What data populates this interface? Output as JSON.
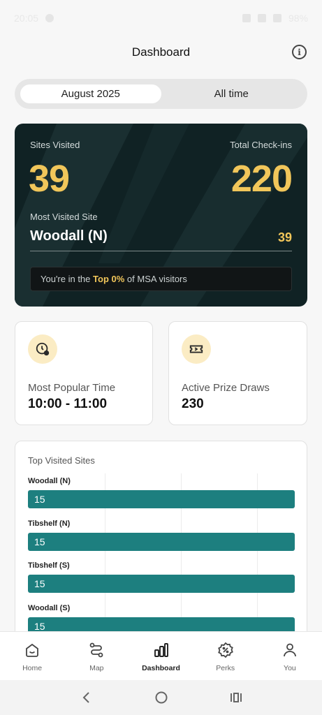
{
  "status_bar": {
    "time": "20:05",
    "battery": "98%"
  },
  "header": {
    "title": "Dashboard"
  },
  "segment": {
    "options": [
      "August 2025",
      "All time"
    ],
    "selected": "August 2025"
  },
  "hero": {
    "sites_visited_label": "Sites Visited",
    "sites_visited_value": "39",
    "checkins_label": "Total Check-ins",
    "checkins_value": "220",
    "most_visited_label": "Most Visited Site",
    "most_visited_site": "Woodall (N)",
    "most_visited_count": "39",
    "rank_prefix": "You're in the",
    "rank_highlight": "Top 0%",
    "rank_suffix": "of MSA visitors"
  },
  "stats": [
    {
      "label": "Most Popular Time",
      "value": "10:00 - 11:00",
      "icon": "clock-icon"
    },
    {
      "label": "Active Prize Draws",
      "value": "230",
      "icon": "ticket-icon"
    }
  ],
  "top_sites": {
    "title": "Top Visited Sites",
    "items": [
      {
        "name": "Woodall (N)",
        "value": "15"
      },
      {
        "name": "Tibshelf (N)",
        "value": "15"
      },
      {
        "name": "Tibshelf (S)",
        "value": "15"
      },
      {
        "name": "Woodall (S)",
        "value": "15"
      }
    ]
  },
  "bottom_nav": {
    "items": [
      {
        "label": "Home",
        "icon": "home-icon"
      },
      {
        "label": "Map",
        "icon": "route-icon"
      },
      {
        "label": "Dashboard",
        "icon": "bar-chart-icon"
      },
      {
        "label": "Perks",
        "icon": "discount-badge-icon"
      },
      {
        "label": "You",
        "icon": "user-icon"
      }
    ],
    "active": "Dashboard"
  },
  "colors": {
    "accent": "#f1c65a",
    "teal": "#1d7f7f",
    "hero_bg": "#102224"
  }
}
